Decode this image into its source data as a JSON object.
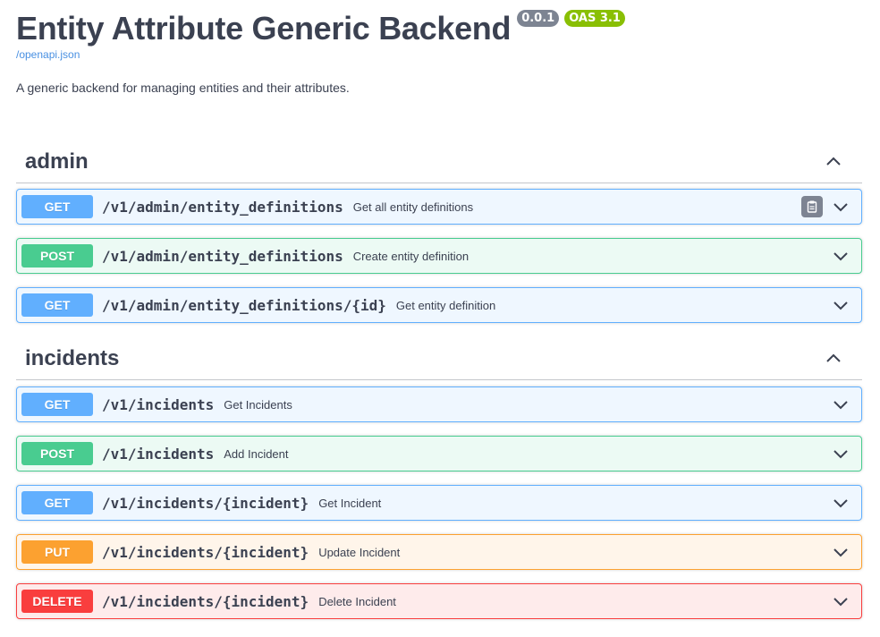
{
  "info": {
    "title": "Entity Attribute Generic Backend",
    "version": "0.0.1",
    "oas": "OAS 3.1",
    "spec_link": "/openapi.json",
    "description": "A generic backend for managing entities and their attributes."
  },
  "colors": {
    "get": "#61affe",
    "post": "#49cc90",
    "put": "#fca130",
    "delete": "#f93e3e",
    "version_badge": "#7d8492",
    "oas_badge": "#89bf04"
  },
  "tags": [
    {
      "name": "admin",
      "operations": [
        {
          "method": "GET",
          "path": "/v1/admin/entity_definitions",
          "summary": "Get all entity definitions"
        },
        {
          "method": "POST",
          "path": "/v1/admin/entity_definitions",
          "summary": "Create entity definition"
        },
        {
          "method": "GET",
          "path": "/v1/admin/entity_definitions/{id}",
          "summary": "Get entity definition"
        }
      ]
    },
    {
      "name": "incidents",
      "operations": [
        {
          "method": "GET",
          "path": "/v1/incidents",
          "summary": "Get Incidents"
        },
        {
          "method": "POST",
          "path": "/v1/incidents",
          "summary": "Add Incident"
        },
        {
          "method": "GET",
          "path": "/v1/incidents/{incident}",
          "summary": "Get Incident"
        },
        {
          "method": "PUT",
          "path": "/v1/incidents/{incident}",
          "summary": "Update Incident"
        },
        {
          "method": "DELETE",
          "path": "/v1/incidents/{incident}",
          "summary": "Delete Incident"
        }
      ]
    }
  ],
  "icons": {
    "copy": "clipboard-icon",
    "expand": "chevron-down-icon",
    "collapse": "chevron-up-icon"
  }
}
